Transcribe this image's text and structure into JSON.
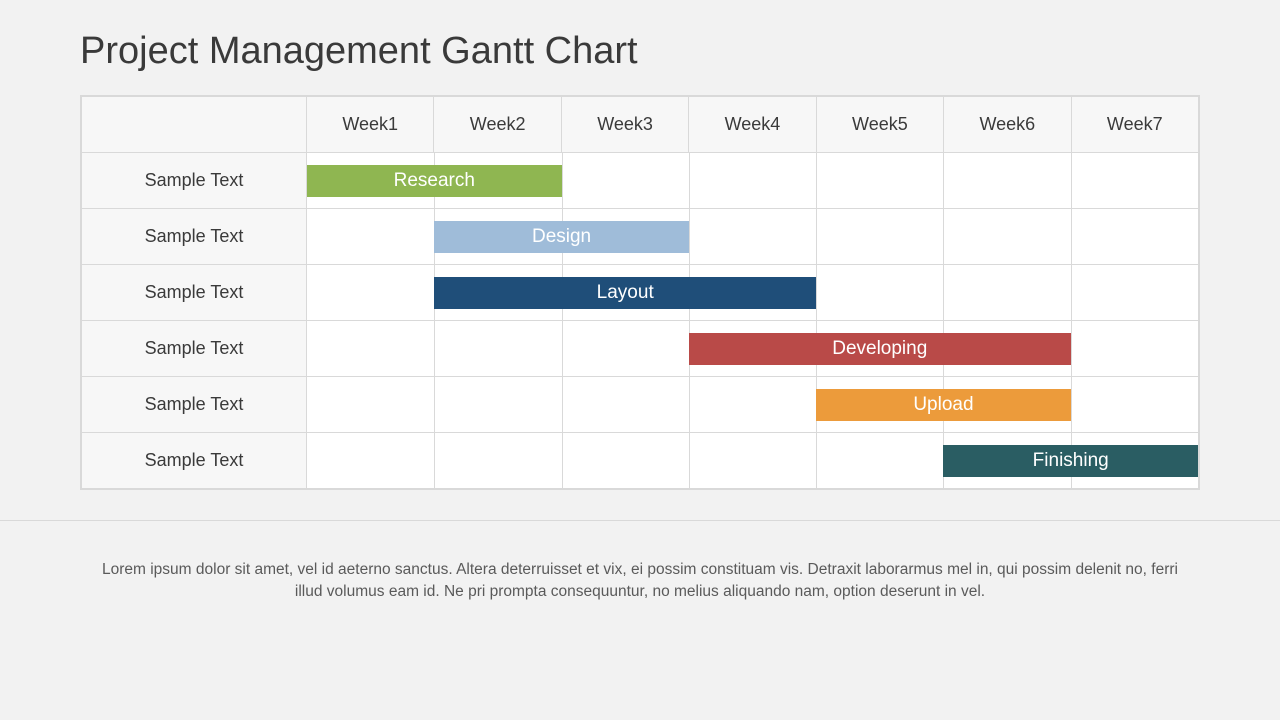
{
  "title": "Project Management Gantt Chart",
  "footer": "Lorem ipsum dolor sit amet, vel id aeterno sanctus. Altera deterruisset et vix, ei possim constituam vis. Detraxit laborarmus mel in, qui possim delenit no, ferri illud volumus eam id. Ne pri prompta consequuntur, no melius aliquando nam, option deserunt in vel.",
  "chart_data": {
    "type": "bar",
    "title": "Project Management Gantt Chart",
    "xlabel": "",
    "ylabel": "",
    "columns": [
      "Week1",
      "Week2",
      "Week3",
      "Week4",
      "Week5",
      "Week6",
      "Week7"
    ],
    "row_labels": [
      "Sample Text",
      "Sample Text",
      "Sample Text",
      "Sample Text",
      "Sample Text",
      "Sample Text"
    ],
    "tasks": [
      {
        "name": "Research",
        "start": 1,
        "end": 2,
        "color": "#8fb651"
      },
      {
        "name": "Design",
        "start": 2,
        "end": 3,
        "color": "#9fbcd9"
      },
      {
        "name": "Layout",
        "start": 2,
        "end": 4,
        "color": "#1f4e79"
      },
      {
        "name": "Developing",
        "start": 4,
        "end": 6,
        "color": "#b94a48"
      },
      {
        "name": "Upload",
        "start": 5,
        "end": 6,
        "color": "#ec9b3b"
      },
      {
        "name": "Finishing",
        "start": 6,
        "end": 7,
        "color": "#2a5d63"
      }
    ],
    "xlim": [
      1,
      7
    ]
  }
}
